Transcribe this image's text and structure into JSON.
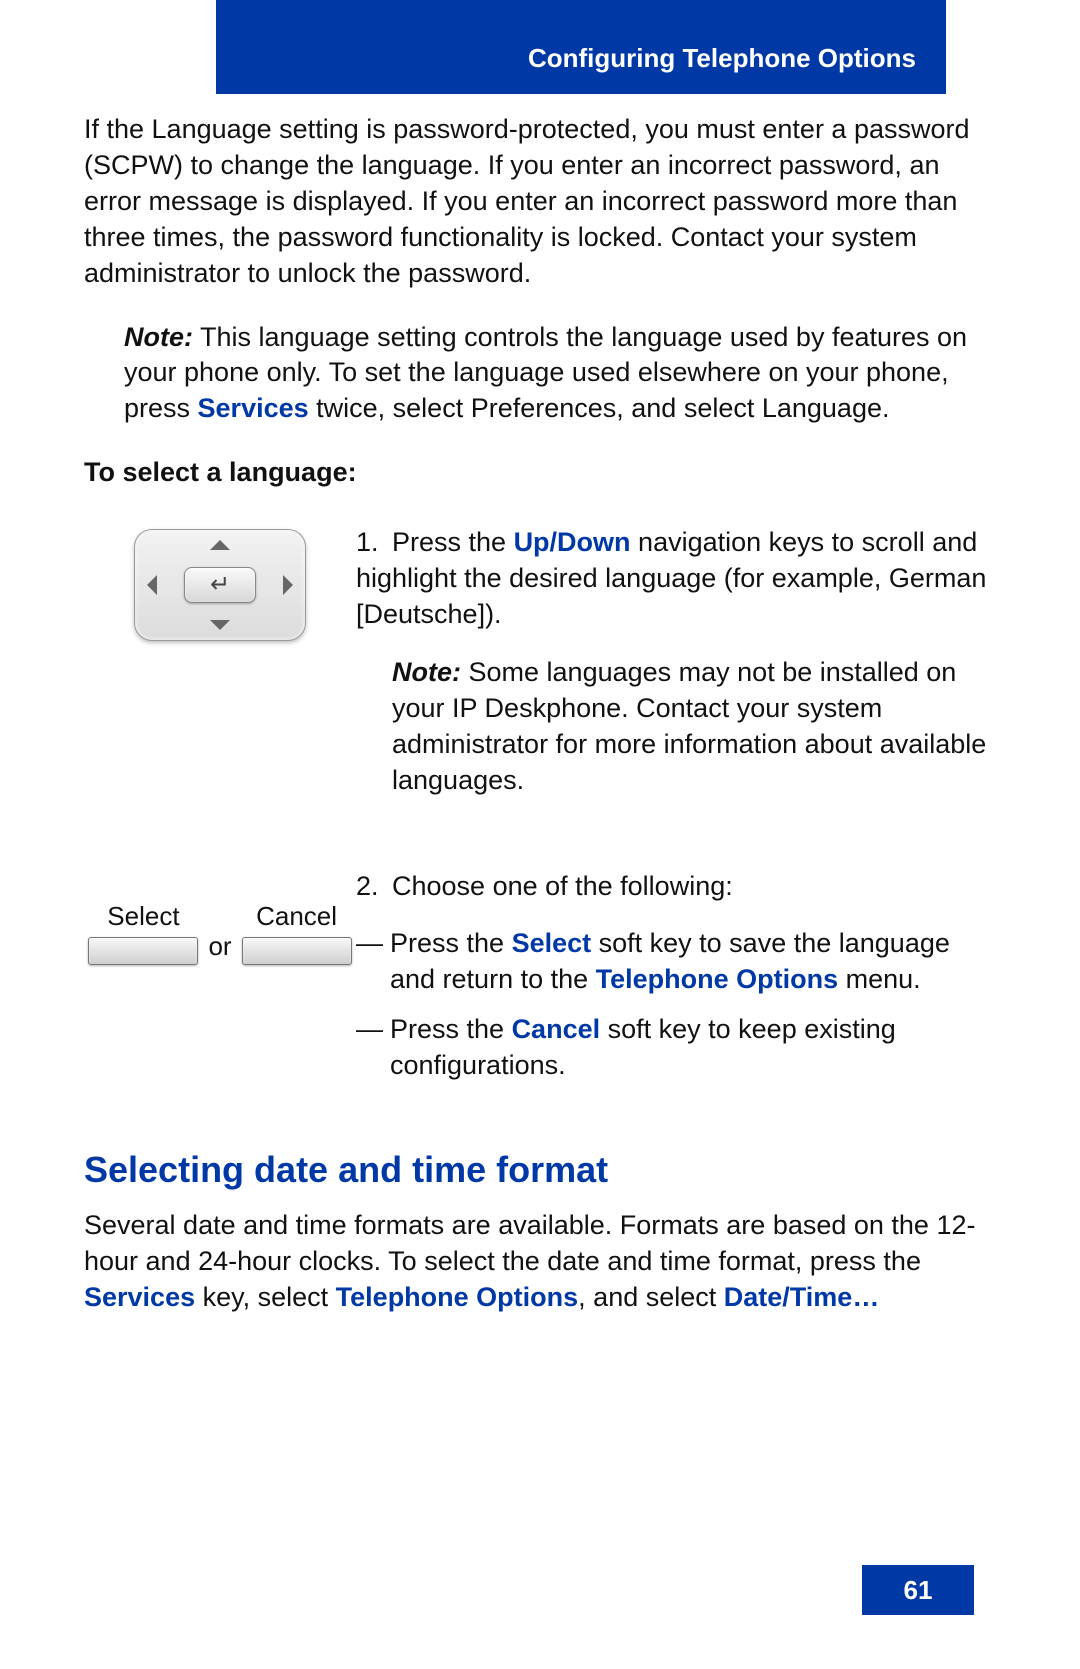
{
  "header": {
    "title": "Configuring Telephone Options"
  },
  "intro": {
    "text": "If the Language setting is password-protected, you must enter a password (SCPW) to change the language. If you enter an incorrect password, an error message is displayed. If you enter an incorrect password more than three times, the password functionality is locked. Contact your system administrator to unlock the password."
  },
  "note1": {
    "label": "Note:",
    "before_link": " This language setting controls the language used by features on your phone only. To set the language used elsewhere on your phone, press ",
    "link": "Services",
    "after_link": " twice, select Preferences, and select Language."
  },
  "subhead": "To select a language:",
  "step1": {
    "num": "1.",
    "before_link": "Press the ",
    "link": "Up/Down",
    "after_link": " navigation keys to scroll and highlight the desired language (for example, German [Deutsche]).",
    "note_label": "Note:",
    "note_text": " Some languages may not be installed on your IP Deskphone. Contact your system administrator for more information about available languages."
  },
  "softkeys": {
    "select_label": "Select",
    "or": "or",
    "cancel_label": "Cancel"
  },
  "step2": {
    "num": "2.",
    "lead": "Choose one of the following:",
    "opt_a_pre": "Press the ",
    "opt_a_link1": "Select",
    "opt_a_mid": " soft key to save the language and return to the ",
    "opt_a_link2": "Telephone Options",
    "opt_a_post": " menu.",
    "opt_b_pre": "Press the ",
    "opt_b_link": "Cancel",
    "opt_b_post": " soft key to keep existing configurations."
  },
  "section": {
    "heading": "Selecting date and time format",
    "para_pre": "Several date and time formats are available. Formats are based on the 12-hour and 24-hour clocks. To select the date and time format, press the ",
    "link1": "Services",
    "mid1": " key, select ",
    "link2": "Telephone Options",
    "mid2": ", and select ",
    "link3": "Date/Time…"
  },
  "page_number": "61",
  "dash": "—"
}
